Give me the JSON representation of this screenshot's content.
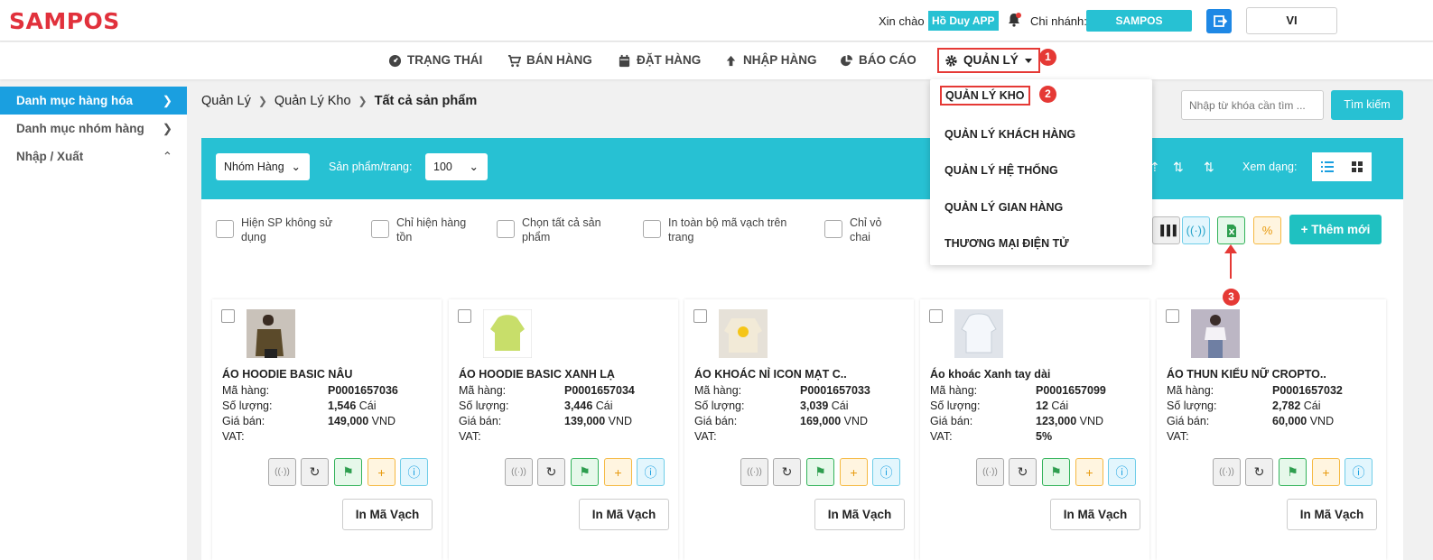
{
  "header": {
    "logo": "SAMPOS",
    "greeting": "Xin chào",
    "user": "Hồ Duy APP",
    "branch_label": "Chi nhánh:",
    "branch": "SAMPOS",
    "lang": "VI"
  },
  "nav": {
    "items": [
      "TRẠNG THÁI",
      "BÁN HÀNG",
      "ĐẶT HÀNG",
      "NHẬP HÀNG",
      "BÁO CÁO",
      "QUẢN LÝ"
    ]
  },
  "dropdown": {
    "items": [
      "QUẢN LÝ KHO",
      "QUẢN LÝ KHÁCH HÀNG",
      "QUẢN LÝ HỆ THỐNG",
      "QUẢN LÝ GIAN HÀNG",
      "THƯƠNG MẠI ĐIỆN TỬ"
    ]
  },
  "badges": [
    "1",
    "2",
    "3"
  ],
  "sidebar": {
    "items": [
      "Danh mục hàng hóa",
      "Danh mục nhóm hàng",
      "Nhập / Xuất"
    ]
  },
  "breadcrumb": [
    "Quản Lý",
    "Quản Lý Kho",
    "Tất cả sản phẩm"
  ],
  "search": {
    "placeholder": "Nhập từ khóa cần tìm ...",
    "button": "Tìm kiếm"
  },
  "toolbar": {
    "group_select": "Nhóm Hàng",
    "per_page_label": "Sản phẩm/trang:",
    "per_page": "100",
    "view_label": "Xem dạng:"
  },
  "filters": [
    "Hiện SP không sử dụng",
    "Chỉ hiện hàng tồn",
    "Chọn tất cả sản phẩm",
    "In toàn bộ mã vạch trên trang",
    "Chỉ vỏ chai"
  ],
  "add_new": "+ Thêm mới",
  "labels": {
    "code": "Mã hàng:",
    "qty": "Số lượng:",
    "price": "Giá bán:",
    "vat": "VAT:",
    "print": "In Mã Vạch"
  },
  "products": [
    {
      "name": "ÁO HOODIE BASIC NÂU",
      "code": "P0001657036",
      "qty": "1,546",
      "unit": "Cái",
      "price": "149,000",
      "currency": "VND",
      "vat": ""
    },
    {
      "name": "ÁO HOODIE BASIC XANH LẠ",
      "code": "P0001657034",
      "qty": "3,446",
      "unit": "Cái",
      "price": "139,000",
      "currency": "VND",
      "vat": ""
    },
    {
      "name": "ÁO KHOÁC NỈ ICON MẠT C..",
      "code": "P0001657033",
      "qty": "3,039",
      "unit": "Cái",
      "price": "169,000",
      "currency": "VND",
      "vat": ""
    },
    {
      "name": "Áo khoác Xanh tay dài",
      "code": "P0001657099",
      "qty": "12",
      "unit": "Cái",
      "price": "123,000",
      "currency": "VND",
      "vat": "5%"
    },
    {
      "name": "ÁO THUN KIỂU NỮ CROPTO..",
      "code": "P0001657032",
      "qty": "2,782",
      "unit": "Cái",
      "price": "60,000",
      "currency": "VND",
      "vat": ""
    }
  ],
  "colors": {
    "brand": "#e1313c",
    "teal": "#27c1d3",
    "active": "#1a9fe0",
    "annot": "#e53935"
  }
}
